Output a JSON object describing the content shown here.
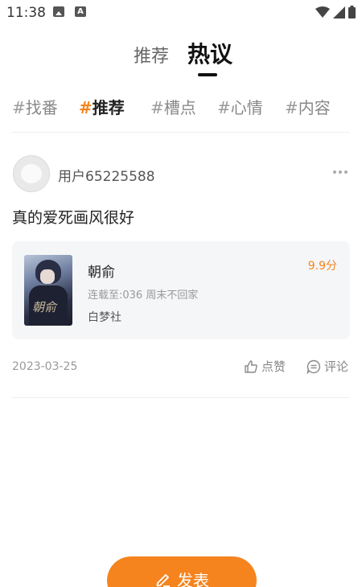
{
  "status_bar": {
    "time": "11:38",
    "icons": [
      "image-notification-icon",
      "a-notification-icon",
      "wifi-icon",
      "cell-signal-icon",
      "battery-icon"
    ]
  },
  "top_tabs": [
    {
      "label": "推荐",
      "active": false
    },
    {
      "label": "热议",
      "active": true
    }
  ],
  "categories": [
    {
      "hash": "#",
      "label": "找番",
      "active": false
    },
    {
      "hash": "#",
      "label": "推荐",
      "active": true
    },
    {
      "hash": "#",
      "label": "槽点",
      "active": false
    },
    {
      "hash": "#",
      "label": "心情",
      "active": false
    },
    {
      "hash": "#",
      "label": "内容",
      "active": false
    }
  ],
  "post": {
    "username": "用户65225588",
    "text": "真的爱死画风很好",
    "comic": {
      "name": "朝俞",
      "score": "9.9分",
      "status": "连载至:036 周末不回家",
      "publisher": "白梦社",
      "cover_title": "朝俞"
    },
    "date": "2023-03-25",
    "like_label": "点赞",
    "comment_label": "评论"
  },
  "publish_label": "发表",
  "colors": {
    "accent": "#f5841f",
    "card_bg": "#f5f6f8",
    "text_primary": "#222222",
    "text_secondary": "#999999"
  }
}
